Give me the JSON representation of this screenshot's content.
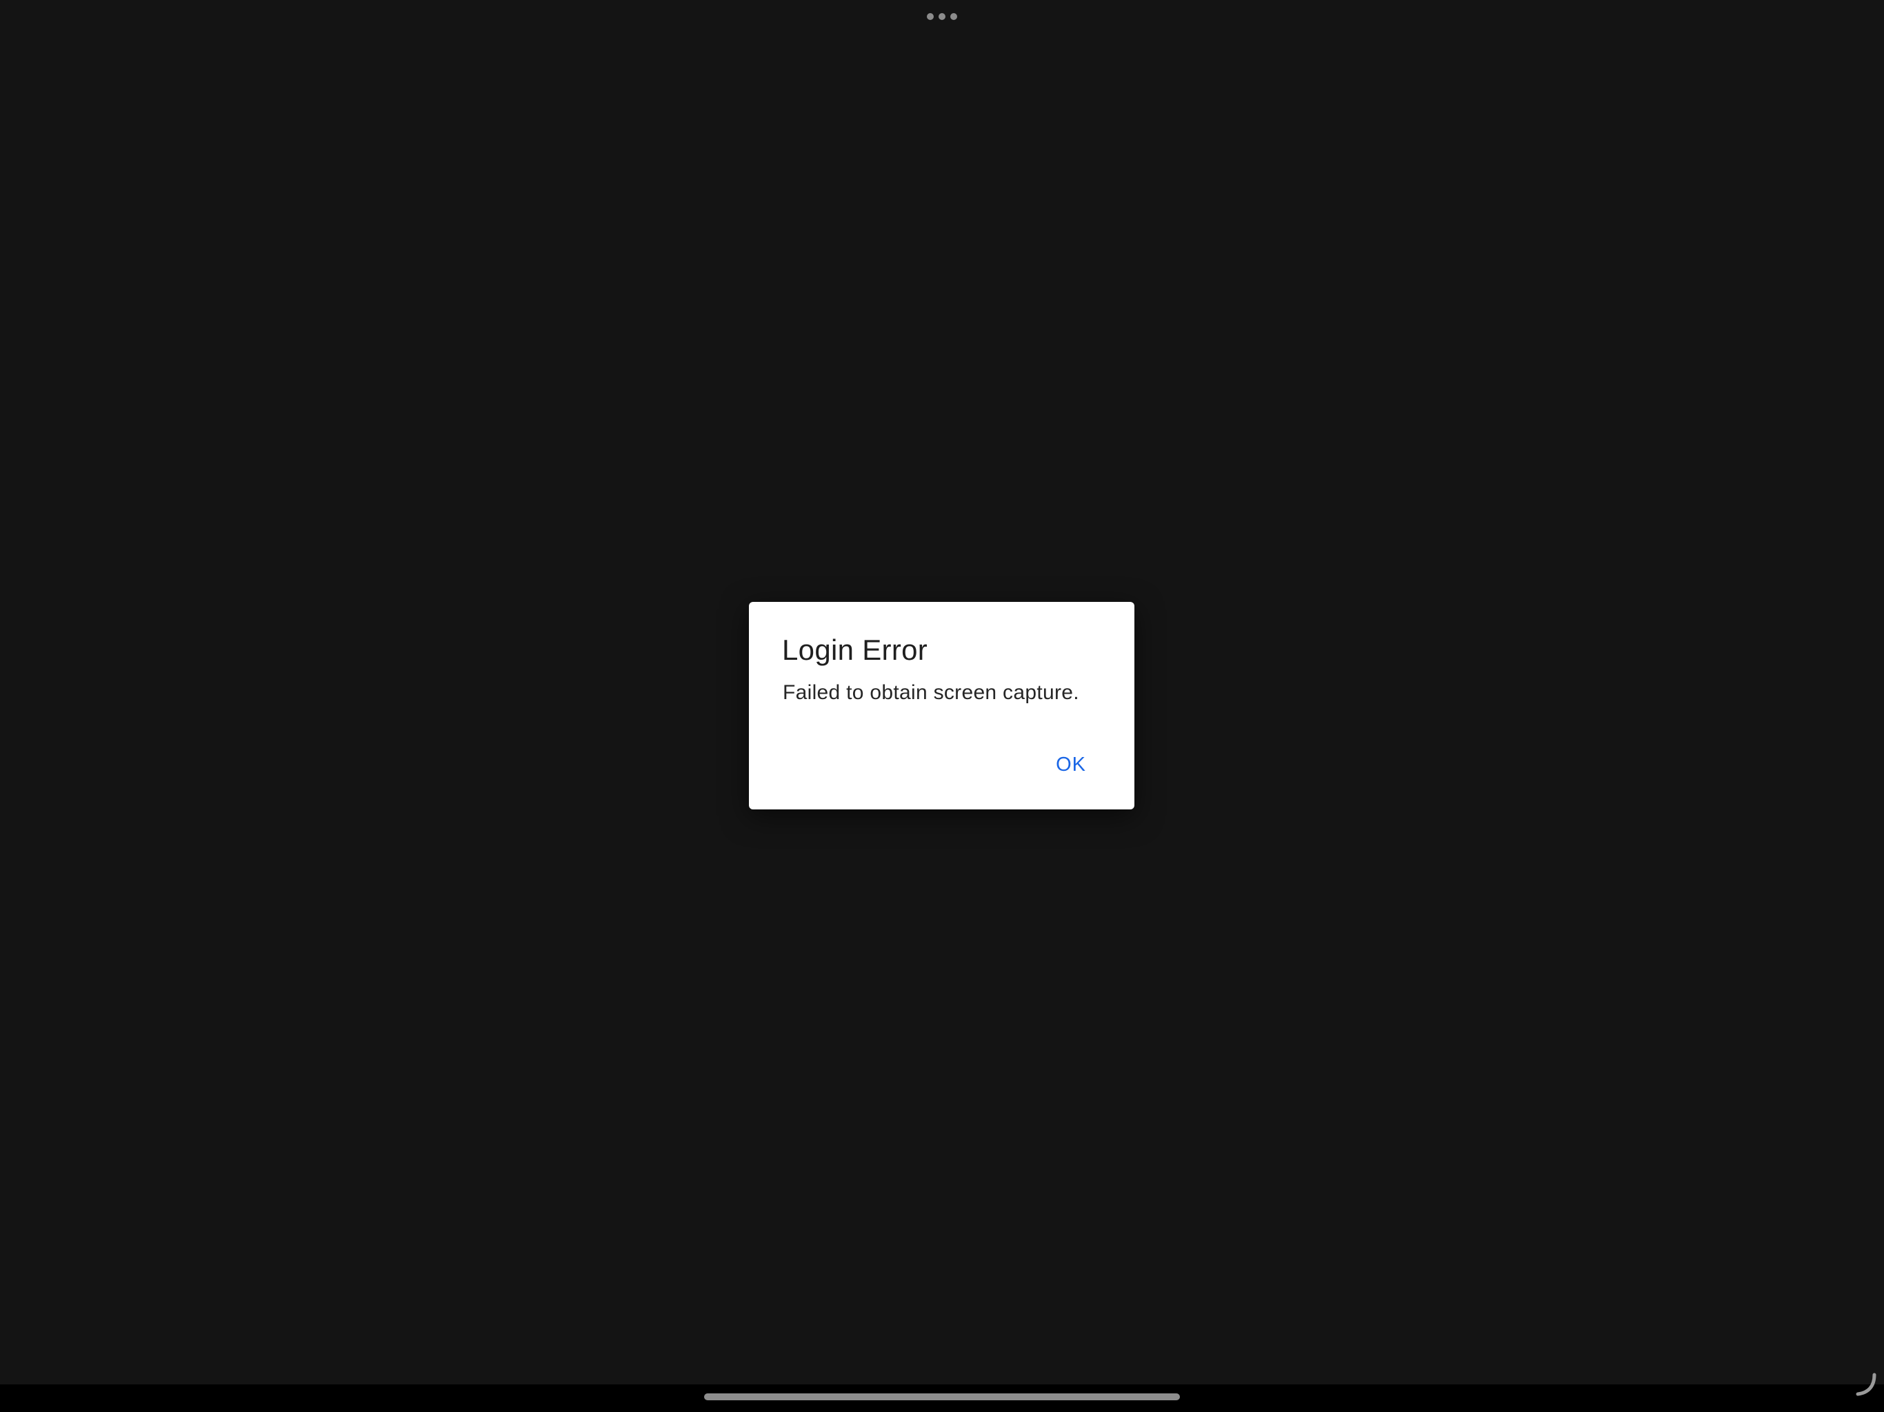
{
  "top_bar": {
    "multitasking_icon": "ellipsis-icon"
  },
  "dialog": {
    "title": "Login Error",
    "message": "Failed to obtain screen capture.",
    "ok_label": "OK"
  },
  "bottom": {
    "corner_icon": "resize-handle-icon"
  },
  "colors": {
    "background": "#141414",
    "dialog_background": "#ffffff",
    "accent": "#1a66e6"
  }
}
